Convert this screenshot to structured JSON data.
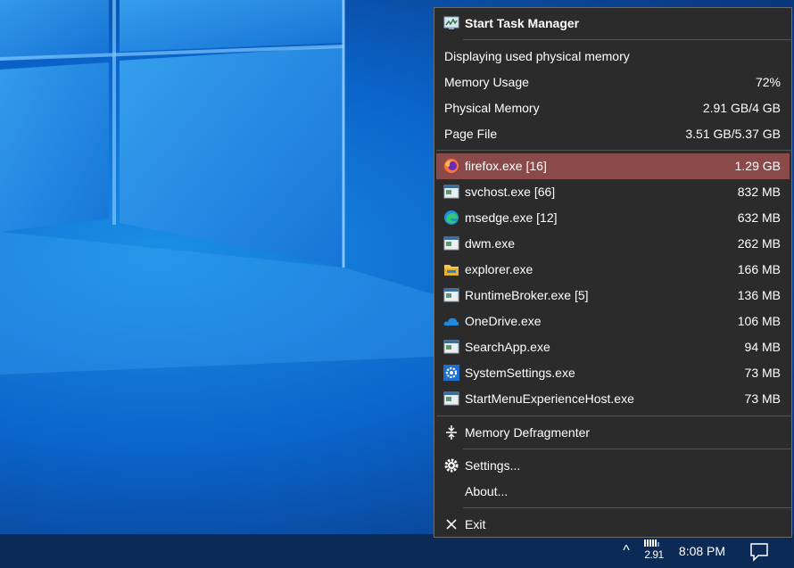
{
  "menu": {
    "title": "Start Task Manager",
    "info": {
      "mode": "Displaying used physical memory",
      "memory_usage_label": "Memory Usage",
      "memory_usage_value": "72%",
      "physical_memory_label": "Physical Memory",
      "physical_memory_value": "2.91 GB/4 GB",
      "page_file_label": "Page File",
      "page_file_value": "3.51 GB/5.37 GB"
    },
    "processes": [
      {
        "name": "firefox.exe [16]",
        "mem": "1.29 GB",
        "icon": "firefox-icon"
      },
      {
        "name": "svchost.exe [66]",
        "mem": "832 MB",
        "icon": "app-window-icon"
      },
      {
        "name": "msedge.exe [12]",
        "mem": "632 MB",
        "icon": "edge-icon"
      },
      {
        "name": "dwm.exe",
        "mem": "262 MB",
        "icon": "app-window-icon"
      },
      {
        "name": "explorer.exe",
        "mem": "166 MB",
        "icon": "folder-icon"
      },
      {
        "name": "RuntimeBroker.exe [5]",
        "mem": "136 MB",
        "icon": "app-window-icon"
      },
      {
        "name": "OneDrive.exe",
        "mem": "106 MB",
        "icon": "cloud-icon"
      },
      {
        "name": "SearchApp.exe",
        "mem": "94 MB",
        "icon": "app-window-icon"
      },
      {
        "name": "SystemSettings.exe",
        "mem": "73 MB",
        "icon": "settings-gear-icon"
      },
      {
        "name": "StartMenuExperienceHost.exe",
        "mem": "73 MB",
        "icon": "app-window-icon"
      }
    ],
    "defrag_label": "Memory Defragmenter",
    "settings_label": "Settings...",
    "about_label": "About...",
    "exit_label": "Exit"
  },
  "taskbar": {
    "memory_tray_value": "2.91",
    "clock": "8:08 PM"
  },
  "colors": {
    "menu_bg": "#2b2b2b",
    "highlight": "#8b4a4a",
    "taskbar": "#0b2a55",
    "desktop": "#0a63c9"
  }
}
